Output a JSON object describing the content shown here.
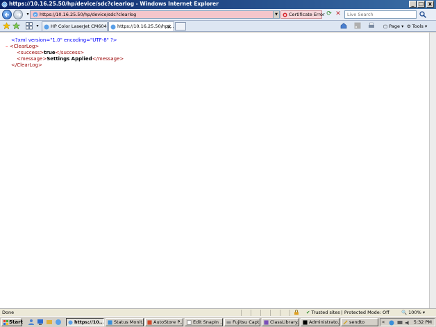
{
  "window": {
    "title": "https://10.16.25.50/hp/device/sdc?clearlog - Windows Internet Explorer",
    "min_label": "_",
    "max_label": "□",
    "close_label": "x"
  },
  "addressbar": {
    "url": "https://10.16.25.50/hp/device/sdc?clearlog",
    "certificate_error": "Certificate Error",
    "search_placeholder": "Live Search"
  },
  "tabs": [
    {
      "label": "HP Color LaserJet CM6040 M...",
      "active": false
    },
    {
      "label": "https://10.16.25.50/hp/...",
      "active": true
    }
  ],
  "commands": {
    "page": "Page",
    "tools": "Tools"
  },
  "xml": {
    "declaration": "<?xml version=\"1.0\" encoding=\"UTF-8\" ?>",
    "collapse": "–",
    "root_open": "<ClearLog>",
    "success_open": "<success>",
    "success_value": "true",
    "success_close": "</success>",
    "message_open": "<message>",
    "message_value": "Settings Applied",
    "message_close": "</message>",
    "root_close": "</ClearLog>"
  },
  "status": {
    "text": "Done",
    "zone": "Trusted sites | Protected Mode: Off",
    "zoom": "100%"
  },
  "taskbar": {
    "start": "Start",
    "items": [
      {
        "label": "https://10...",
        "active": true
      },
      {
        "label": "Status Monit...",
        "active": false
      },
      {
        "label": "AutoStore P...",
        "active": false
      },
      {
        "label": "Edit SnapIn ...",
        "active": false
      },
      {
        "label": "Fujitsu Capt...",
        "active": false
      },
      {
        "label": "ClassLibrary...",
        "active": false
      },
      {
        "label": "Administrato...",
        "active": false
      },
      {
        "label": "sendto",
        "active": false
      }
    ],
    "clock": "5:32 PM"
  }
}
